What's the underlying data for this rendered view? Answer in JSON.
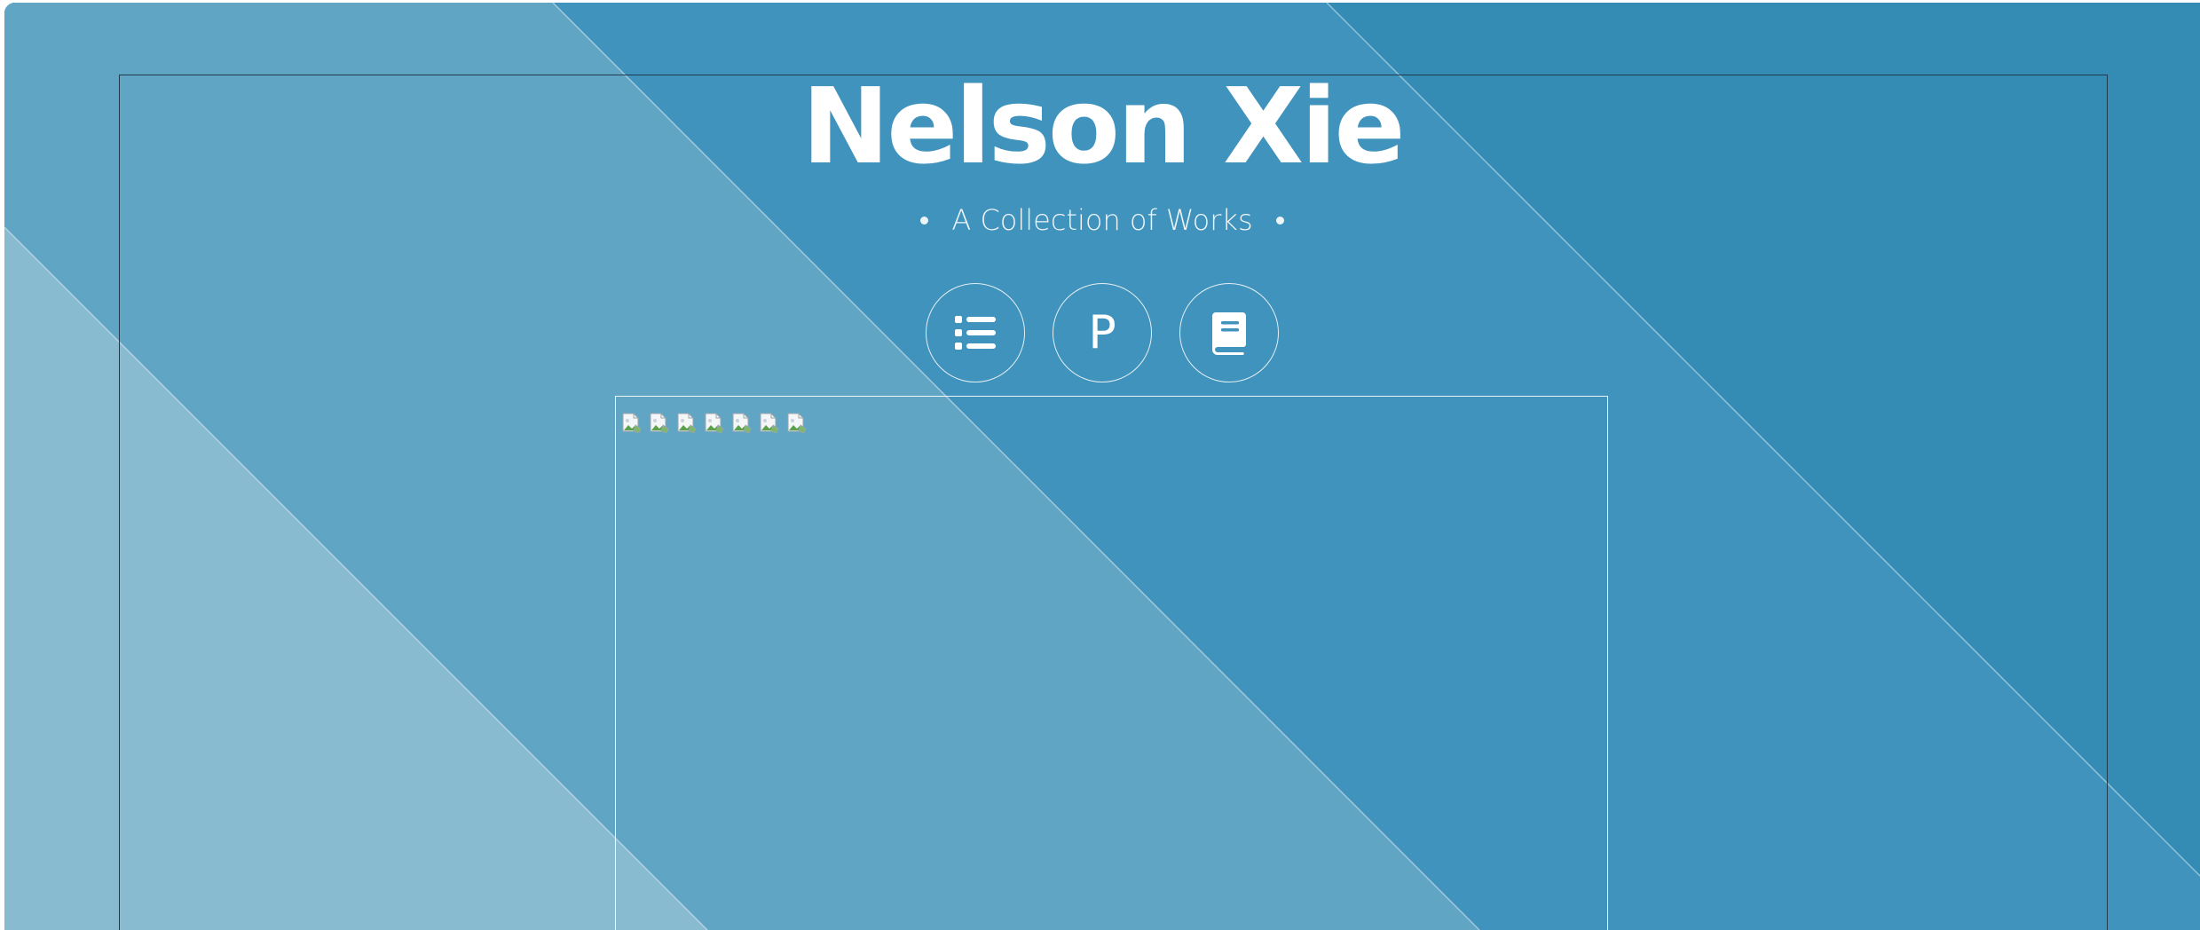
{
  "site": {
    "title": "Nelson Xie",
    "subtitle": "A Collection of Works"
  },
  "nav": {
    "buttons": [
      {
        "name": "list",
        "icon": "list-icon"
      },
      {
        "name": "p",
        "icon": "p-letter-icon",
        "label": "P"
      },
      {
        "name": "book",
        "icon": "book-icon"
      }
    ]
  },
  "gallery": {
    "broken_image_count": 7,
    "thumb_icon": "broken-image-icon"
  },
  "colors": {
    "background": "#348cb5",
    "band_light": "#88bad0",
    "band_mid": "#61a5c5",
    "band_dark": "#4093bc",
    "text": "#ffffff"
  }
}
